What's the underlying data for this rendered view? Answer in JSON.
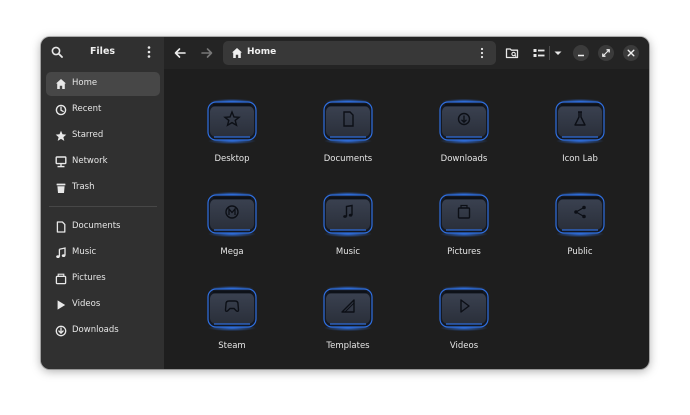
{
  "sidebar": {
    "title": "Files",
    "places": [
      {
        "label": "Home",
        "icon": "home-icon",
        "active": true
      },
      {
        "label": "Recent",
        "icon": "clock-icon",
        "active": false
      },
      {
        "label": "Starred",
        "icon": "star-icon",
        "active": false
      },
      {
        "label": "Network",
        "icon": "network-icon",
        "active": false
      },
      {
        "label": "Trash",
        "icon": "trash-icon",
        "active": false
      }
    ],
    "bookmarks": [
      {
        "label": "Documents",
        "icon": "document-icon"
      },
      {
        "label": "Music",
        "icon": "music-icon"
      },
      {
        "label": "Pictures",
        "icon": "pictures-icon"
      },
      {
        "label": "Videos",
        "icon": "video-icon"
      },
      {
        "label": "Downloads",
        "icon": "download-icon"
      }
    ]
  },
  "header": {
    "location": "Home"
  },
  "folders": [
    {
      "name": "Desktop",
      "emblem": "star"
    },
    {
      "name": "Documents",
      "emblem": "doc"
    },
    {
      "name": "Downloads",
      "emblem": "download"
    },
    {
      "name": "Icon Lab",
      "emblem": "flask"
    },
    {
      "name": "Mega",
      "emblem": "mega"
    },
    {
      "name": "Music",
      "emblem": "music"
    },
    {
      "name": "Pictures",
      "emblem": "picture"
    },
    {
      "name": "Public",
      "emblem": "share"
    },
    {
      "name": "Steam",
      "emblem": "gamepad"
    },
    {
      "name": "Templates",
      "emblem": "template"
    },
    {
      "name": "Videos",
      "emblem": "play"
    }
  ],
  "colors": {
    "folder_glow": "#2f6fe0",
    "folder_body": "#2a2f3a",
    "sidebar_bg": "#303030",
    "content_bg": "#1e1e1e"
  }
}
